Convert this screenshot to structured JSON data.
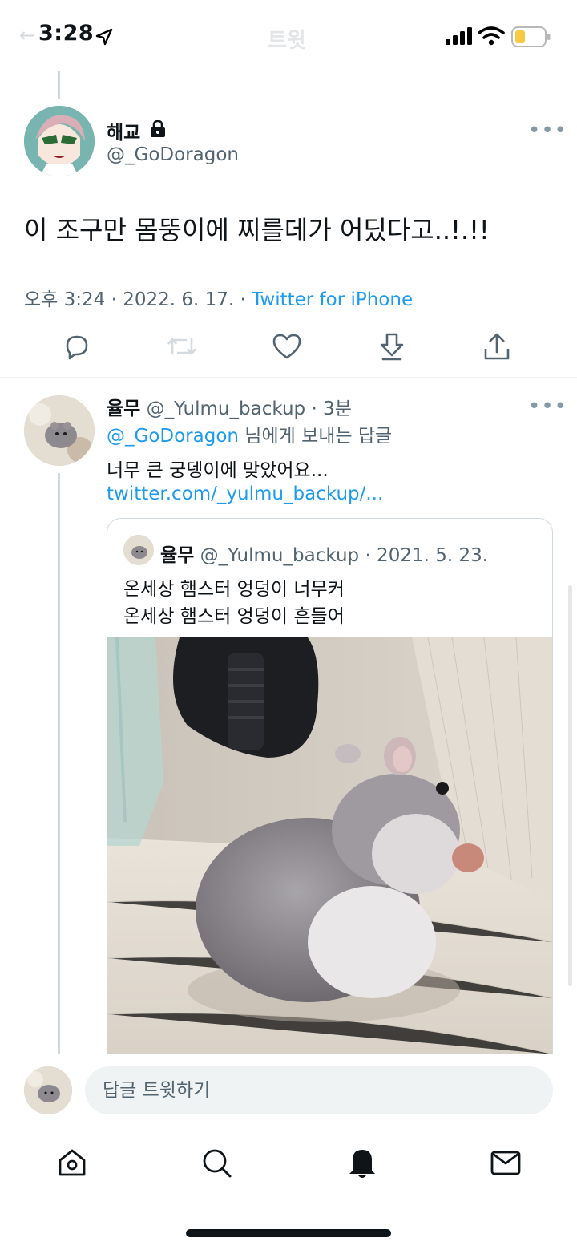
{
  "status_bar": {
    "time": "3:28",
    "icons": [
      "location-arrow-icon",
      "signal-icon",
      "wifi-icon",
      "battery-icon"
    ]
  },
  "nav": {
    "title": "트윗"
  },
  "tweet": {
    "display_name": "해교",
    "handle": "@_GoDoragon",
    "text": "이 조구만 몸뚱이에 찌를데가 어딨다고..!.!!",
    "meta_prefix": "오후 3:24 · 2022. 6. 17. · ",
    "source": "Twitter for iPhone",
    "actions": [
      "reply-icon",
      "retweet-icon",
      "like-icon",
      "bookmark-icon",
      "share-icon"
    ]
  },
  "reply": {
    "display_name": "율무",
    "meta": " @_Yulmu_backup · 3분",
    "replying_mention": "@_GoDoragon",
    "replying_suffix": " 님에게 보내는 답글",
    "text": "너무 큰 궁뎅이에 맞았어요...",
    "link": "twitter.com/_yulmu_backup/..."
  },
  "quote": {
    "display_name": "율무",
    "meta": " @_Yulmu_backup · 2021. 5. 23.",
    "lines": [
      "온세상 햄스터 엉덩이 너무커",
      "온세상 햄스터 엉덩이 흔들어"
    ]
  },
  "composer": {
    "placeholder": "답글 트윗하기"
  },
  "tabbar": [
    "home-icon",
    "search-icon",
    "notifications-icon",
    "messages-icon"
  ],
  "colors": {
    "accent": "#1d9bf0",
    "text": "#0f1419",
    "secondary": "#536471"
  }
}
